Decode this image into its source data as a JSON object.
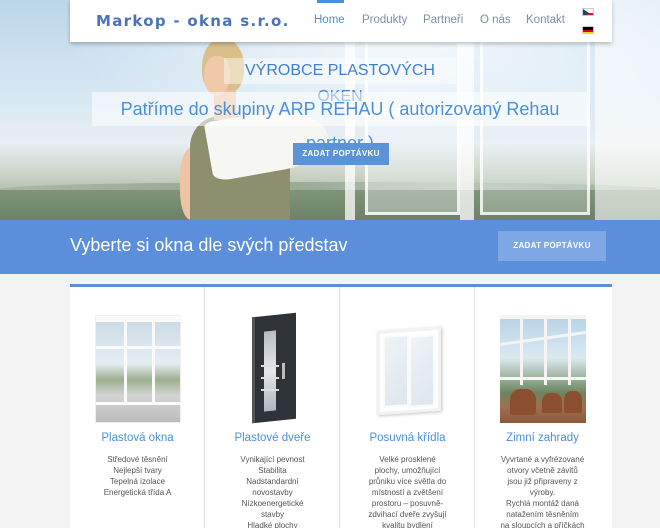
{
  "header": {
    "logo": "Markop - okna s.r.o.",
    "nav": [
      {
        "label": "Home",
        "active": true
      },
      {
        "label": "Produkty",
        "active": false
      },
      {
        "label": "Partneři",
        "active": false
      },
      {
        "label": "O nás",
        "active": false
      },
      {
        "label": "Kontakt",
        "active": false
      }
    ],
    "languages": [
      "czech-flag-icon",
      "german-flag-icon"
    ]
  },
  "hero": {
    "title": "VÝROBCE PLASTOVÝCH OKEN",
    "subtitle": "Patříme do skupiny ARP REHAU ( autorizovaný Rehau partner )",
    "button": "ZADAT POPTÁVKU"
  },
  "banner": {
    "text": "Vyberte si okna dle svých představ",
    "button": "ZADAT POPTÁVKU"
  },
  "products": [
    {
      "title": "Plastová okna",
      "lines": [
        "Středové těsnění",
        "Nejlepší tvary",
        "Tepelná izolace",
        "Energetická třída A"
      ]
    },
    {
      "title": "Plastové dveře",
      "lines": [
        "Vynikající pevnost",
        "Stabilita",
        "Nadstandardní",
        "novostavby",
        "Nízkoenergetické",
        "stavby",
        "Hladké plochy"
      ]
    },
    {
      "title": "Posuvná křídla",
      "lines": [
        "Velké prosklené",
        "plochy, umožňující",
        "průniku více světla do",
        "místností a zvětšení",
        "prostoru – posuvně-",
        "zdvihací dveře zvyšují",
        "kvalitu bydlení"
      ]
    },
    {
      "title": "Zimní zahrady",
      "lines": [
        "Vyvrtané a vyfrézované",
        "otvory včetně závitů",
        "jsou již připraveny z",
        "výroby.",
        "Rychlá montáž daná",
        "natažením těsněním",
        "na sloupcích a příčkách"
      ]
    }
  ],
  "colors": {
    "accent": "#4a8fdc",
    "banner": "#5b8fdc",
    "logo": "#4a72b8"
  }
}
